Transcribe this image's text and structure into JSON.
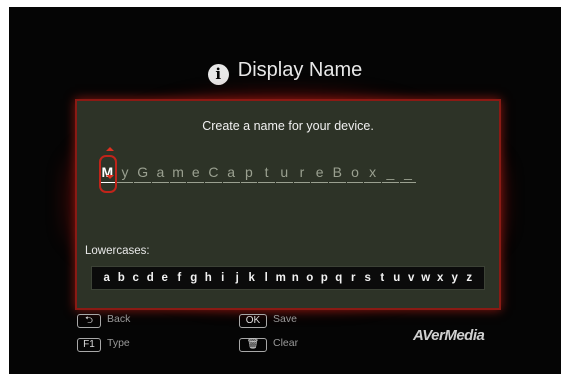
{
  "header": {
    "title": "Display Name",
    "icon": "info-icon"
  },
  "prompt": "Create a name for your device.",
  "name_field": {
    "characters": [
      "M",
      "y",
      "G",
      "a",
      "m",
      "e",
      "C",
      "a",
      "p",
      "t",
      "u",
      "r",
      "e",
      "B",
      "o",
      "x",
      "_",
      "_"
    ]
  },
  "keyboard": {
    "label": "Lowercases:",
    "keys": [
      "a",
      "b",
      "c",
      "d",
      "e",
      "f",
      "g",
      "h",
      "i",
      "j",
      "k",
      "l",
      "m",
      "n",
      "o",
      "p",
      "q",
      "r",
      "s",
      "t",
      "u",
      "v",
      "w",
      "x",
      "y",
      "z"
    ]
  },
  "legend": {
    "back": {
      "key": "⮌",
      "label": "Back"
    },
    "type": {
      "key": "F1",
      "label": "Type"
    },
    "save": {
      "key": "OK",
      "label": "Save"
    },
    "clear": {
      "key": "🗑",
      "label": "Clear"
    }
  },
  "brand": "AVerMedia",
  "colors": {
    "panel": "#2d3327",
    "accent": "#c0241a",
    "background": "#050505"
  }
}
